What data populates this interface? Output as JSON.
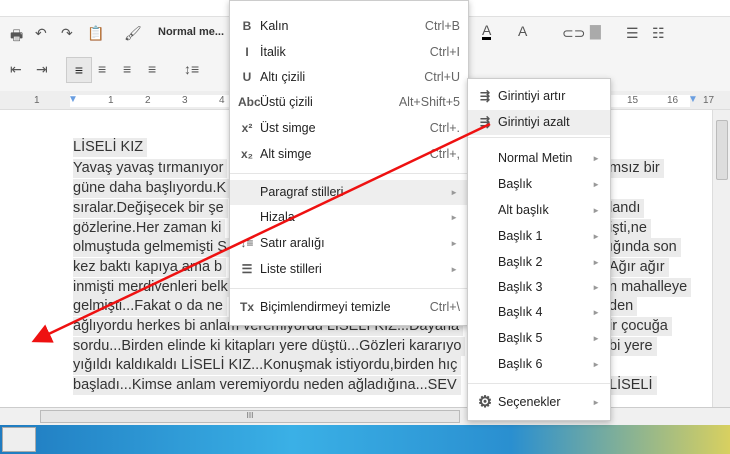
{
  "toolbar": {
    "style_select": "Normal me...",
    "icons": [
      "print-icon",
      "undo-icon",
      "redo-icon",
      "paste-icon",
      "paint-format-icon",
      "text-color-icon",
      "highlight-color-icon",
      "link-icon",
      "image-icon",
      "numbered-list-icon",
      "bulleted-list-icon",
      "decrease-indent-icon",
      "increase-indent-icon",
      "align-left-icon",
      "align-center-icon",
      "align-right-icon",
      "justify-icon",
      "line-spacing-icon"
    ]
  },
  "ruler": {
    "ticks": [
      "1",
      "1",
      "2",
      "3",
      "4",
      "15",
      "16",
      "17"
    ]
  },
  "document": {
    "left_lines": [
      "LİSELİ KIZ",
      "Yavaş yavaş tırmanıyor",
      "güne daha başlıyordu.K",
      "sıralar.Değişecek bir şe",
      "gözlerine.Her zaman ki",
      "olmuştuda gelmemişti S",
      "kez baktı kapıya ama b",
      "inmişti merdivenleri belk",
      "gelmişti...Fakat o da ne",
      "ağlıyordu herkes bi anlam veremiyordu LİSELİ KIZ...Dayana",
      "sordu...Birden elinde ki kitapları yere düştü...Gözleri kararıyo",
      "yığıldı kaldıkaldı LİSELİ KIZ...Konuşmak istiyordu,birden hıç",
      "başladı...Kimse anlam veremiyordu neden ağladığına...SEV"
    ],
    "right_lines": [
      "msız bir",
      "",
      "landı",
      "işti,ne",
      "ığında son",
      "Ağır ağır",
      "n mahalleye",
      "den",
      "ir çocuğa",
      "bi yere",
      "",
      "LİSELİ"
    ]
  },
  "format_menu": {
    "items": [
      {
        "icon": "B",
        "label": "Kalın",
        "shortcut": "Ctrl+B"
      },
      {
        "icon": "I",
        "label": "İtalik",
        "shortcut": "Ctrl+I"
      },
      {
        "icon": "U",
        "label": "Altı çizili",
        "shortcut": "Ctrl+U"
      },
      {
        "icon": "Abc",
        "label": "Üstü çizili",
        "shortcut": "Alt+Shift+5"
      },
      {
        "icon": "x²",
        "label": "Üst simge",
        "shortcut": "Ctrl+."
      },
      {
        "icon": "x₂",
        "label": "Alt simge",
        "shortcut": "Ctrl+,"
      },
      {
        "icon": "",
        "label": "Paragraf stilleri",
        "arrow": "►"
      },
      {
        "icon": "",
        "label": "Hizala",
        "arrow": "►"
      },
      {
        "icon": "↕≡",
        "label": "Satır aralığı",
        "arrow": "►"
      },
      {
        "icon": "☰",
        "label": "Liste stilleri",
        "arrow": "►"
      },
      {
        "icon": "Tx",
        "label": "Biçimlendirmeyi temizle",
        "shortcut": "Ctrl+\\"
      }
    ]
  },
  "paragraph_submenu": {
    "items": [
      {
        "icon": "indent",
        "label": "Girintiyi artır"
      },
      {
        "icon": "outdent",
        "label": "Girintiyi azalt"
      },
      {
        "label": "Normal Metin",
        "arrow": "►"
      },
      {
        "label": "Başlık",
        "arrow": "►"
      },
      {
        "label": "Alt başlık",
        "arrow": "►"
      },
      {
        "label": "Başlık 1",
        "arrow": "►"
      },
      {
        "label": "Başlık 2",
        "arrow": "►"
      },
      {
        "label": "Başlık 3",
        "arrow": "►"
      },
      {
        "label": "Başlık 4",
        "arrow": "►"
      },
      {
        "label": "Başlık 5",
        "arrow": "►"
      },
      {
        "label": "Başlık 6",
        "arrow": "►"
      },
      {
        "icon": "⚙",
        "label": "Seçenekler",
        "arrow": "►"
      }
    ]
  },
  "annotation": {
    "arrow_color": "#ee1111"
  },
  "scrollbar": {
    "grip": "III"
  }
}
